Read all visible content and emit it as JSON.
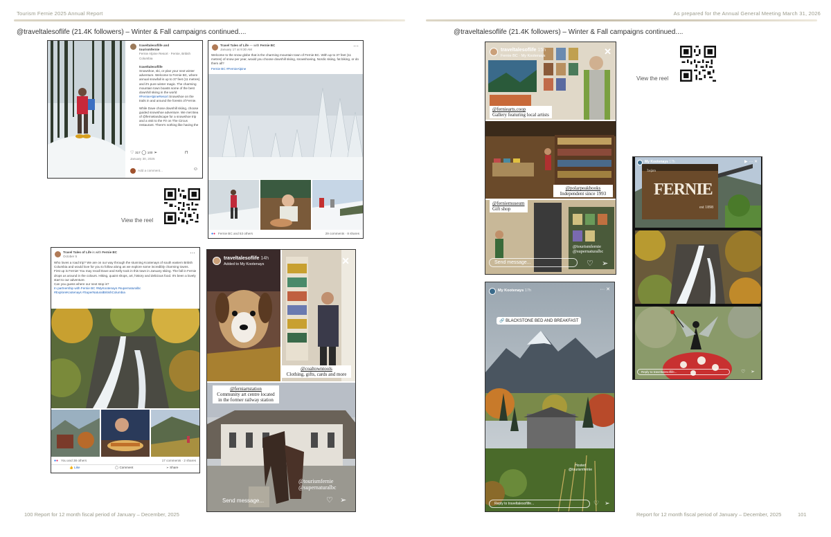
{
  "header_left": "Tourism Fernie 2025 Annual Report",
  "header_right": "As prepared for the Annual General Meeting March 31, 2026",
  "campaign_left": "@traveltalesoflife (21.4K followers) – Winter & Fall campaigns continued....",
  "campaign_right": "@traveltalesoflife (21.4K followers) – Winter & Fall campaigns continued....",
  "view_reel_1": "View the reel",
  "view_reel_2": "View the reel",
  "footer_left": "100 Report for 12 month fiscal period of January – December, 2025",
  "footer_right": "Report for 12 month fiscal period of January – December, 2025",
  "footer_right_num": "101",
  "ig_post": {
    "account": "traveltalesoflife and",
    "account2": "tourismfernie",
    "location": "Fernie Alpine Resort · Fernie, British Columbia",
    "caption_user": "traveltalesoflife",
    "caption_1": "Snowshoe, ski, or plan your next winter adventure. Welcome to Fernie BC, where annual snowfall is up to 37 feet (11 metres) and it's pure winter magic.",
    "caption_2": "The charming mountain town boasts some of the best downhill skiing in the world",
    "tag": "#FernieAlpineResort",
    "caption_3": "Snowshoe on the trails in and around the forests of Fernie.",
    "caption_4": "While Dave chose downhill skiing, choose guided snowshoe adventure. We met Bea of @fernielandscape for a snowshoe trip and a visit to the Fir on The Circus restaurant. There's nothing like having the whole day ahead of us. The trail is out in the forest, there are multiple choices for all abilities.",
    "likes": "317",
    "comments": "100",
    "date": "January 30, 2025",
    "add_comment": "Add a comment..."
  },
  "fb_post_1": {
    "account": "Travel Tales of Life",
    "with": "Fernie BC",
    "date": "January 17 at 9:30 AM",
    "text": "Welcome to the snow globe that is the charming mountain town of Fernie BC. With up to 37 feet (11 metres) of snow per year, would you choose downhill skiing, snowshoeing, Nordic skiing, fat biking, or do them all?",
    "tags": "Fernie BC #FernieAlpine",
    "reactions": "Fernie BC and 53 others",
    "stats": "29 comments · 8 shares"
  },
  "fb_post_2": {
    "account": "Travel Tales of Life",
    "with": "Fernie BC",
    "date": "October 5",
    "text_1": "Who loves a road trip? We are on our way through the stunning Kootenays of south eastern British Columbia and would love for you to follow along as we explore some incredibly charming towns.",
    "text_2": "First up is Fernie! You may recall Dave and Kelly took in this town in January skiing. The fall in Fernie drops us around in the colours. Hiking, quaint shops, art, history and delicious food. It's been a lovely start to our adventure.",
    "text_3": "Can you guess where our next stop is?",
    "text_4": "In partnership with Fernie BC #MyKootenays #supernaturalbc",
    "tags": "#ExploreKootenays #SuperNaturalBritishColumbia",
    "reactions": "You and 38 others",
    "stats": "17 comments · 2 shares",
    "like": "Like",
    "comment": "Comment",
    "share": "Share"
  },
  "story_1": {
    "account": "traveltalesoflife",
    "time": "14h",
    "sub": "Added to My Kootenays",
    "label_1_handle": "@coaltowntools",
    "label_1_text": "Clothing, gifts, cards and more",
    "label_2_handle": "@ferniartstation",
    "label_2_text": "Community art centre located in the former railway station",
    "tag_1": "@tourismfernie",
    "tag_2": "@supernaturalbc",
    "send": "Send message..."
  },
  "story_2": {
    "account": "traveltalesoflife",
    "time": "15h",
    "sub": "Fernie BC · My Kootenays",
    "label_1_handle": "@ferniearts.coop",
    "label_1_text": "Gallery featuring local artists",
    "label_2_handle": "@polarpeakbooks",
    "label_2_text": "Independent since 1993",
    "label_3_handle": "@ferniemuseum",
    "label_3_text": "Gift shop",
    "tag_1": "@tourismfernie",
    "tag_2": "@supernaturalbc",
    "send": "Send message..."
  },
  "story_3": {
    "account": "My Kootenays",
    "time": "17h",
    "sticker": "BLACKSTONE BED AND BREAKFAST",
    "tag_1": "Hosted",
    "tag_2": "@tourismfernie",
    "reply": "Reply to traveltalesoflife..."
  },
  "story_4": {
    "account": "My Kootenays",
    "time": "17h",
    "sign_word": "FERNIE",
    "sign_year": "est 1898",
    "sign_top": "ʔaq̓am",
    "reply": "Reply to traveltalesoflife..."
  }
}
